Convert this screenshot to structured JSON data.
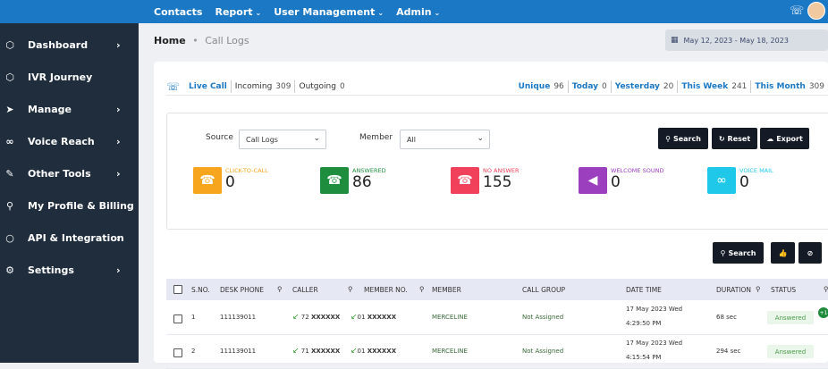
{
  "topnav": {
    "items": [
      "Contacts",
      "Report",
      "User Management",
      "Admin"
    ],
    "has_caret": [
      false,
      true,
      true,
      true
    ]
  },
  "sidebar": {
    "items": [
      {
        "label": "Dashboard",
        "icon": "cube-icon",
        "chevron": true
      },
      {
        "label": "IVR Journey",
        "icon": "cube-icon",
        "chevron": false
      },
      {
        "label": "Manage",
        "icon": "send-icon",
        "chevron": true
      },
      {
        "label": "Voice Reach",
        "icon": "voicemail-icon",
        "chevron": true
      },
      {
        "label": "Other Tools",
        "icon": "pen-icon",
        "chevron": true
      },
      {
        "label": "My Profile & Billing",
        "icon": "user-icon",
        "chevron": false
      },
      {
        "label": "API & Integration",
        "icon": "circle-icon",
        "chevron": true
      },
      {
        "label": "Settings",
        "icon": "gear-icon",
        "chevron": true
      }
    ]
  },
  "breadcrumb": {
    "home": "Home",
    "current": "Call Logs"
  },
  "date_range": "May 12, 2023 - May 18, 2023",
  "tabs": {
    "live": "Live Call",
    "incoming": {
      "label": "Incoming",
      "count": "309"
    },
    "outgoing": {
      "label": "Outgoing",
      "count": "0"
    },
    "unique": {
      "label": "Unique",
      "count": "96"
    },
    "today": {
      "label": "Today",
      "count": "0"
    },
    "yesterday": {
      "label": "Yesterday",
      "count": "20"
    },
    "this_week": {
      "label": "This Week",
      "count": "241"
    },
    "this_month": {
      "label": "This Month",
      "count": "309"
    }
  },
  "filters": {
    "source_label": "Source",
    "source_value": "Call Logs",
    "member_label": "Member",
    "member_value": "All",
    "search": "Search",
    "reset": "Reset",
    "export": "Export"
  },
  "stats": [
    {
      "label": "CLICK-TO-CALL",
      "value": "0",
      "color": "#f7a51c",
      "label_color": "#f7a51c"
    },
    {
      "label": "ANSWERED",
      "value": "86",
      "color": "#1e8e3e",
      "label_color": "#1e8e3e"
    },
    {
      "label": "NO ANSWER",
      "value": "155",
      "color": "#f0405a",
      "label_color": "#f0405a"
    },
    {
      "label": "WELCOME SOUND",
      "value": "0",
      "color": "#9b3fbf",
      "label_color": "#9b3fbf"
    },
    {
      "label": "VOICE MAIL",
      "value": "0",
      "color": "#1fc8e8",
      "label_color": "#1fc8e8"
    }
  ],
  "table_search": "Search",
  "table": {
    "headers": [
      "S.NO.",
      "DESK PHONE",
      "CALLER",
      "MEMBER NO.",
      "MEMBER",
      "CALL GROUP",
      "DATE TIME",
      "DURATION",
      "STATUS"
    ],
    "rows": [
      {
        "sno": "1",
        "desk": "111139011",
        "caller_prefix": "72",
        "caller_mask": "XXXXXX",
        "member_prefix": "01",
        "member_mask": "XXXXXX",
        "member": "MERCELINE",
        "group": "Not Assigned",
        "date": "17 May 2023 Wed",
        "time": "4:29:50 PM",
        "duration": "68 sec",
        "status": "Answered",
        "plus": "+1"
      },
      {
        "sno": "2",
        "desk": "111139011",
        "caller_prefix": "71",
        "caller_mask": "XXXXXX",
        "member_prefix": "01",
        "member_mask": "XXXXXX",
        "member": "MERCELINE",
        "group": "Not Assigned",
        "date": "17 May 2023 Wed",
        "time": "4:15:54 PM",
        "duration": "294 sec",
        "status": "Answered",
        "plus": ""
      }
    ]
  }
}
